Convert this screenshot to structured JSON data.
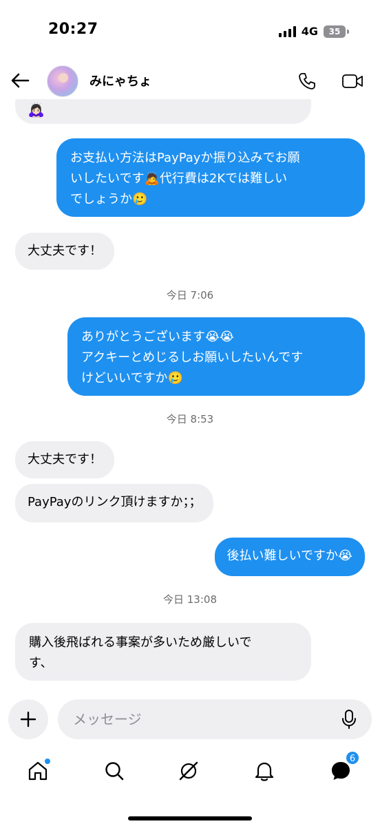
{
  "status_bar": {
    "time": "20:27",
    "network": "4G",
    "battery": "35"
  },
  "header": {
    "contact_name": "みにゃちょ"
  },
  "messages": [
    {
      "side": "incoming",
      "text": "🙇🏻‍♀️"
    },
    {
      "side": "outgoing",
      "lines": [
        "お支払い方法はPayPayか振り込みでお願",
        "いしたいです🙇代行費は2Kでは難しい",
        "でしょうか🥲"
      ]
    },
    {
      "side": "incoming",
      "text": "大丈夫です！"
    },
    {
      "side": "time",
      "text": "今日 7:06"
    },
    {
      "side": "outgoing",
      "lines": [
        "ありがとうございます😭😭",
        "アクキーとめじるしお願いしたいんです",
        "けどいいですか🥲"
      ]
    },
    {
      "side": "time",
      "text": "今日 8:53"
    },
    {
      "side": "incoming",
      "text": "大丈夫です！"
    },
    {
      "side": "incoming",
      "text": "PayPayのリンク頂けますか；；"
    },
    {
      "side": "outgoing",
      "text": "後払い難しいですか😭"
    },
    {
      "side": "time",
      "text": "今日 13:08"
    },
    {
      "side": "incoming",
      "lines": [
        "購入後飛ばれる事案が多いため厳しいで",
        "す、"
      ]
    }
  ],
  "composer": {
    "placeholder": "メッセージ"
  },
  "nav": {
    "messages_badge": "6"
  },
  "colors": {
    "outgoing_bubble": "#1e90f0",
    "incoming_bubble": "#efeff2",
    "accent": "#1e90f0"
  },
  "icons": [
    "back-arrow-icon",
    "phone-icon",
    "video-icon",
    "plus-icon",
    "mic-icon",
    "home-icon",
    "search-icon",
    "explore-icon",
    "bell-icon",
    "messages-icon"
  ]
}
